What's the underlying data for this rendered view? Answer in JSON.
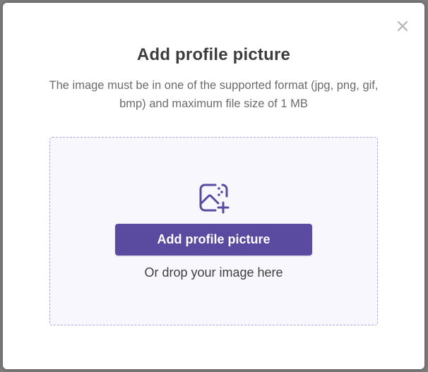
{
  "modal": {
    "title": "Add profile picture",
    "description": "The image must be in one of the supported format (jpg, png, gif, bmp) and maximum file size of 1 MB",
    "close_icon": "close-icon"
  },
  "dropzone": {
    "icon": "add-image-icon",
    "button_label": "Add profile picture",
    "hint": "Or drop your image here"
  },
  "colors": {
    "accent": "#5a4aa0",
    "dropzone_bg": "#f8f7fd",
    "dropzone_border": "#b3a4e6",
    "backdrop": "#7d7d7d"
  }
}
